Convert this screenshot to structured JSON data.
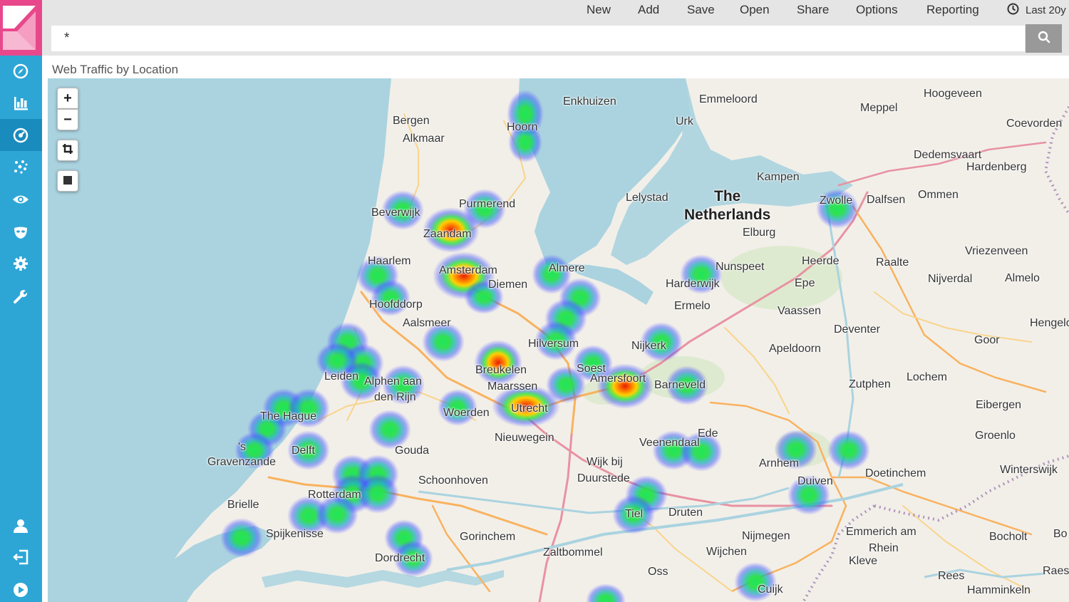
{
  "menu": {
    "items": [
      "New",
      "Add",
      "Save",
      "Open",
      "Share",
      "Options",
      "Reporting"
    ],
    "time_range": "Last 20y"
  },
  "search": {
    "query": "*"
  },
  "panel": {
    "title": "Web Traffic by Location"
  },
  "map_controls": {
    "zoom_in": "+",
    "zoom_out": "−"
  },
  "places": [
    "Enkhuizen",
    "Emmeloord",
    "Hoogeveen",
    "Bergen",
    "Hoorn",
    "Meppel",
    "Urk",
    "Alkmaar",
    "Coevorden",
    "Dedemsvaart",
    "Hardenberg",
    "Kampen",
    "Lelystad",
    "Beverwijk",
    "Purmerend",
    "Zwolle",
    "Dalfsen",
    "Ommen",
    "Zaandam",
    "Elburg",
    "Haarlem",
    "Almere",
    "Nunspeet",
    "Heerde",
    "Raalte",
    "Vriezenveen",
    "Amsterdam",
    "Diemen",
    "Harderwijk",
    "Nijverdal",
    "Almelo",
    "Epe",
    "Hoofddorp",
    "Ermelo",
    "Vaassen",
    "Aalsmeer",
    "Deventer",
    "Hengelo",
    "Hilversum",
    "Nijkerk",
    "Goor",
    "Apeldoorn",
    "Breukelen",
    "Soest",
    "Leiden",
    "Alphen aan",
    "den Rijn",
    "Amersfoort",
    "Barneveld",
    "Lochem",
    "Maarssen",
    "Zutphen",
    "Eibergen",
    "The Hague",
    "Woerden",
    "Utrecht",
    "Nieuwegein",
    "Ede",
    "Groenlo",
    "Delft",
    "Veenendaal",
    "'s",
    "Gravenzande",
    "Gouda",
    "Wijk bij",
    "Duurstede",
    "Arnhem",
    "Winterswijk",
    "Schoonhoven",
    "Doetinchem",
    "Duiven",
    "Rotterdam",
    "Brielle",
    "Tiel",
    "Druten",
    "Spijkenisse",
    "Gorinchem",
    "Nijmegen",
    "Emmerich am",
    "Rhein",
    "Bocholt",
    "Bo",
    "Zaltbommel",
    "Wijchen",
    "Dordrecht",
    "Kleve",
    "Rees",
    "Oss",
    "Raes",
    "Cuijk",
    "Hamminkeln"
  ],
  "country_label": [
    "The",
    "Netherlands"
  ],
  "heat_colors": {
    "low": "#1ee65a",
    "mid": "#ffd000",
    "high": "#e81e00",
    "halo": "#3c50ff"
  },
  "icons": {
    "sidebar": [
      "kibana-logo-icon",
      "discover-compass-icon",
      "visualize-chart-icon",
      "dashboard-icon",
      "timelion-icon",
      "eye-icon",
      "mask-icon",
      "gear-icon",
      "wrench-icon",
      "user-icon",
      "logout-icon",
      "play-icon"
    ],
    "topbar": [
      "clock-icon",
      "search-icon"
    ],
    "map": [
      "crop-icon",
      "square-icon"
    ]
  }
}
